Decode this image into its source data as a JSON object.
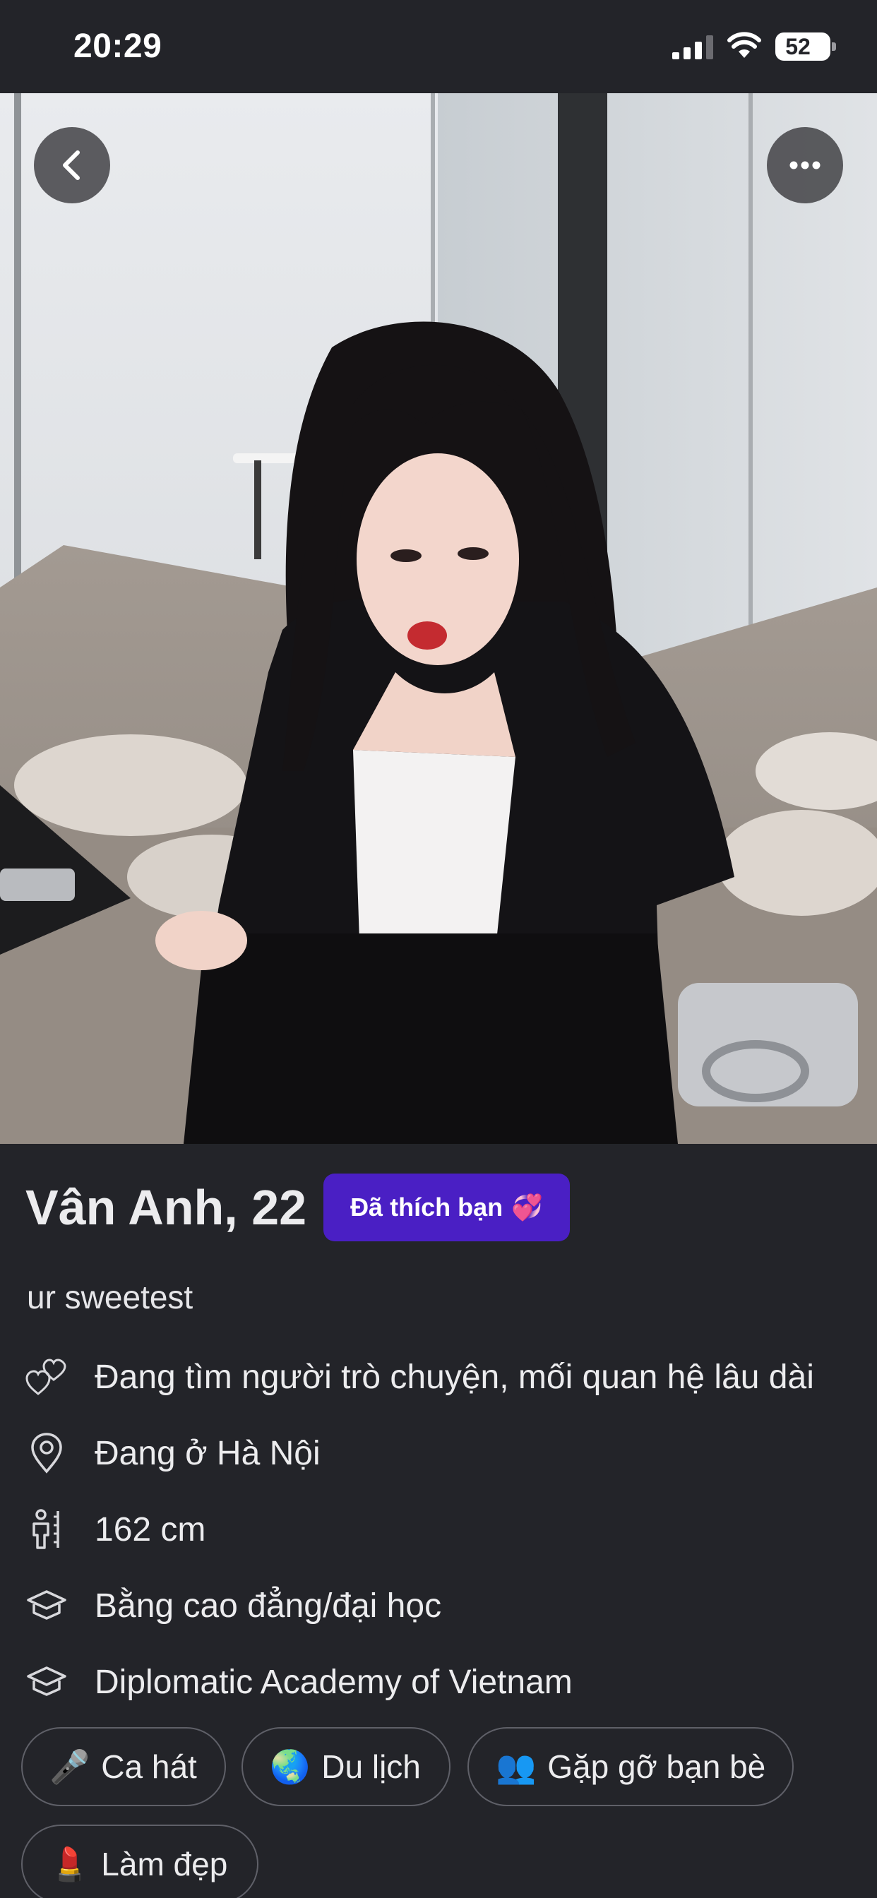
{
  "status_bar": {
    "time": "20:29",
    "battery": "52"
  },
  "profile": {
    "name_age": "Vân Anh, 22",
    "liked_badge": "Đã thích bạn",
    "liked_badge_emoji": "💞",
    "bio": "ur sweetest"
  },
  "info": [
    {
      "icon": "hearts-icon",
      "text": "Đang tìm người trò chuyện, mối quan hệ lâu dài"
    },
    {
      "icon": "location-pin-icon",
      "text": "Đang ở Hà Nội"
    },
    {
      "icon": "height-icon",
      "text": "162 cm"
    },
    {
      "icon": "graduation-cap-icon",
      "text": "Bằng cao đẳng/đại học"
    },
    {
      "icon": "graduation-cap-icon",
      "text": "Diplomatic Academy of Vietnam"
    }
  ],
  "interests": [
    {
      "emoji": "🎤",
      "label": "Ca hát"
    },
    {
      "emoji": "🌏",
      "label": "Du lịch"
    },
    {
      "emoji": "👥",
      "label": "Gặp gỡ bạn bè"
    },
    {
      "emoji": "💄",
      "label": "Làm đẹp"
    }
  ],
  "colors": {
    "background": "#232429",
    "badge": "#4a1fc4",
    "chip_border": "#5f6068"
  }
}
